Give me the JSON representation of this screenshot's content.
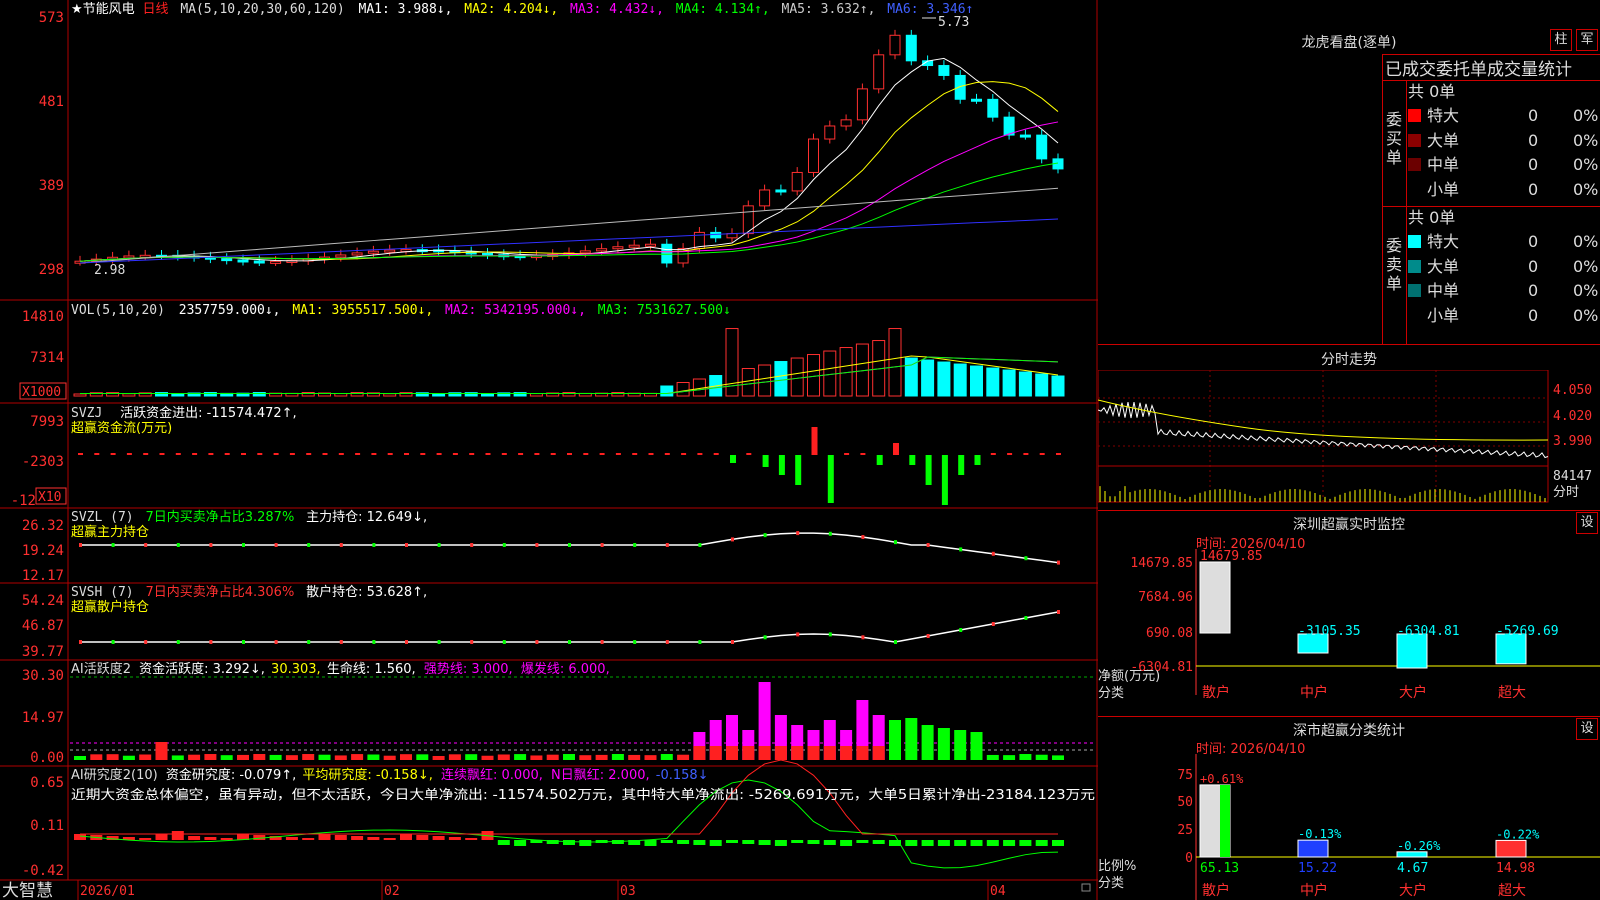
{
  "app": {
    "brand": "大智慧"
  },
  "kline": {
    "stock_name": "★节能风电",
    "period": "日线",
    "ma_label": "MA(5,10,20,30,60,120)",
    "ma_values": [
      {
        "label": "MA1: 3.988↓,",
        "color": "#ffffff"
      },
      {
        "label": "MA2: 4.204↓,",
        "color": "#ffff00"
      },
      {
        "label": "MA3: 4.432↓,",
        "color": "#ff00ff"
      },
      {
        "label": "MA4: 4.134↑,",
        "color": "#00ff00"
      },
      {
        "label": "MA5: 3.632↑,",
        "color": "#cccccc"
      },
      {
        "label": "MA6: 3.346↑",
        "color": "#4040ff"
      }
    ],
    "yticks": [
      "573",
      "481",
      "389",
      "298"
    ],
    "high_label": "5.73",
    "low_label": "2.98"
  },
  "volume": {
    "title": "VOL(5,10,20)",
    "values": [
      {
        "label": "2357759.000↓,",
        "color": "#ffffff"
      },
      {
        "label": "MA1: 3955517.500↓,",
        "color": "#ffff00"
      },
      {
        "label": "MA2: 5342195.000↓,",
        "color": "#ff00ff"
      },
      {
        "label": "MA3: 7531627.500↓",
        "color": "#00ff00"
      }
    ],
    "yticks": [
      "14810",
      "7314"
    ],
    "unit": "X1000"
  },
  "svzj": {
    "title": "SVZJ",
    "value": "活跃资金进出: -11574.472↑,",
    "subtitle": "超赢资金流(万元)",
    "yticks": [
      "7993",
      "-2303",
      "-12"
    ],
    "unit": "X10"
  },
  "svzl": {
    "title": "SVZL (7)",
    "v1": "7日内买卖净占比3.287%",
    "v2": "主力持仓: 12.649↓,",
    "subtitle": "超赢主力持仓",
    "yticks": [
      "26.32",
      "19.24",
      "12.17"
    ]
  },
  "svsh": {
    "title": "SVSH (7)",
    "v1": "7日内买卖净占比4.306%",
    "v2": "散户持仓: 53.628↑,",
    "subtitle": "超赢散户持仓",
    "yticks": [
      "54.24",
      "46.87",
      "39.77"
    ]
  },
  "ai_active": {
    "title": "AI活跃度2",
    "values": [
      {
        "label": "资金活跃度: 3.292↓,",
        "color": "#ffffff"
      },
      {
        "label": "30.303,",
        "color": "#ffff00"
      },
      {
        "label": "生命线: 1.560,",
        "color": "#ffffff"
      },
      {
        "label": "强势线: 3.000,",
        "color": "#ff00ff"
      },
      {
        "label": "爆发线: 6.000,",
        "color": "#ff00ff"
      }
    ],
    "yticks": [
      "30.30",
      "14.97",
      "0.00"
    ]
  },
  "ai_research": {
    "title": "AI研究度2(10)",
    "values": [
      {
        "label": "资金研究度: -0.079↑,",
        "color": "#ffffff"
      },
      {
        "label": "平均研究度: -0.158↓,",
        "color": "#ffff00"
      },
      {
        "label": "连续飘红: 0.000,",
        "color": "#ff00ff"
      },
      {
        "label": "N日飘红: 2.000,",
        "color": "#ff00ff"
      },
      {
        "label": "-0.158↓",
        "color": "#4040ff"
      }
    ],
    "comment": "近期大资金总体偏空，虽有异动，但不太活跃，今日大单净流出: -11574.502万元，其中特大单净流出: -5269.691万元，大单5日累计净出-23184.123万元",
    "yticks": [
      "0.65",
      "0.11",
      "-0.42"
    ]
  },
  "xaxis": {
    "labels": [
      "2026/01",
      "02",
      "03",
      "04"
    ]
  },
  "right": {
    "dragon": {
      "title": "龙虎看盘(逐单)",
      "btn1": "柱",
      "btn2": "军",
      "header": "已成交委托单成交量统计",
      "buy": {
        "side": "委买单",
        "total": "共 0单",
        "rows": [
          {
            "label": "特大",
            "count": "0",
            "pct": "0%",
            "color": "#ff0000"
          },
          {
            "label": "大单",
            "count": "0",
            "pct": "0%",
            "color": "#8b0000"
          },
          {
            "label": "中单",
            "count": "0",
            "pct": "0%",
            "color": "#6b0000"
          },
          {
            "label": "小单",
            "count": "0",
            "pct": "0%",
            "color": "#000000"
          }
        ]
      },
      "sell": {
        "side": "委卖单",
        "total": "共 0单",
        "rows": [
          {
            "label": "特大",
            "count": "0",
            "pct": "0%",
            "color": "#00ffff"
          },
          {
            "label": "大单",
            "count": "0",
            "pct": "0%",
            "color": "#008b8b"
          },
          {
            "label": "中单",
            "count": "0",
            "pct": "0%",
            "color": "#007070"
          },
          {
            "label": "小单",
            "count": "0",
            "pct": "0%",
            "color": "#000000"
          }
        ]
      }
    },
    "intraday": {
      "title": "分时走势",
      "yticks": [
        "4.050",
        "4.020",
        "3.990"
      ],
      "vol_label": "84147",
      "footer": "分时"
    },
    "monitor": {
      "title": "深圳超赢实时监控",
      "btn": "设",
      "time": "时间: 2026/04/10",
      "yticks": [
        "14679.85",
        "7684.96",
        "690.08",
        "-6304.81"
      ],
      "ylabel1": "净额(万元)",
      "ylabel2": "分类",
      "categories": [
        "散户",
        "中户",
        "大户",
        "超大"
      ],
      "value_labels": [
        "14679.85",
        "-3105.35",
        "-6304.81",
        "-5269.69"
      ],
      "values": [
        14679.85,
        -3105.35,
        -6304.81,
        -5269.69
      ]
    },
    "classify": {
      "title": "深市超赢分类统计",
      "btn": "设",
      "time": "时间: 2026/04/10",
      "yticks": [
        "75",
        "50",
        "25",
        "0"
      ],
      "ylabel1": "比例%",
      "ylabel2": "分类",
      "categories": [
        "散户",
        "中户",
        "大户",
        "超大"
      ],
      "top_labels": [
        "+0.61%",
        "-0.13%",
        "-0.26%",
        "-0.22%"
      ],
      "bottom_labels": [
        "65.13",
        "15.22",
        "4.67",
        "14.98"
      ],
      "values": [
        65.13,
        15.22,
        4.67,
        14.98
      ]
    }
  }
}
